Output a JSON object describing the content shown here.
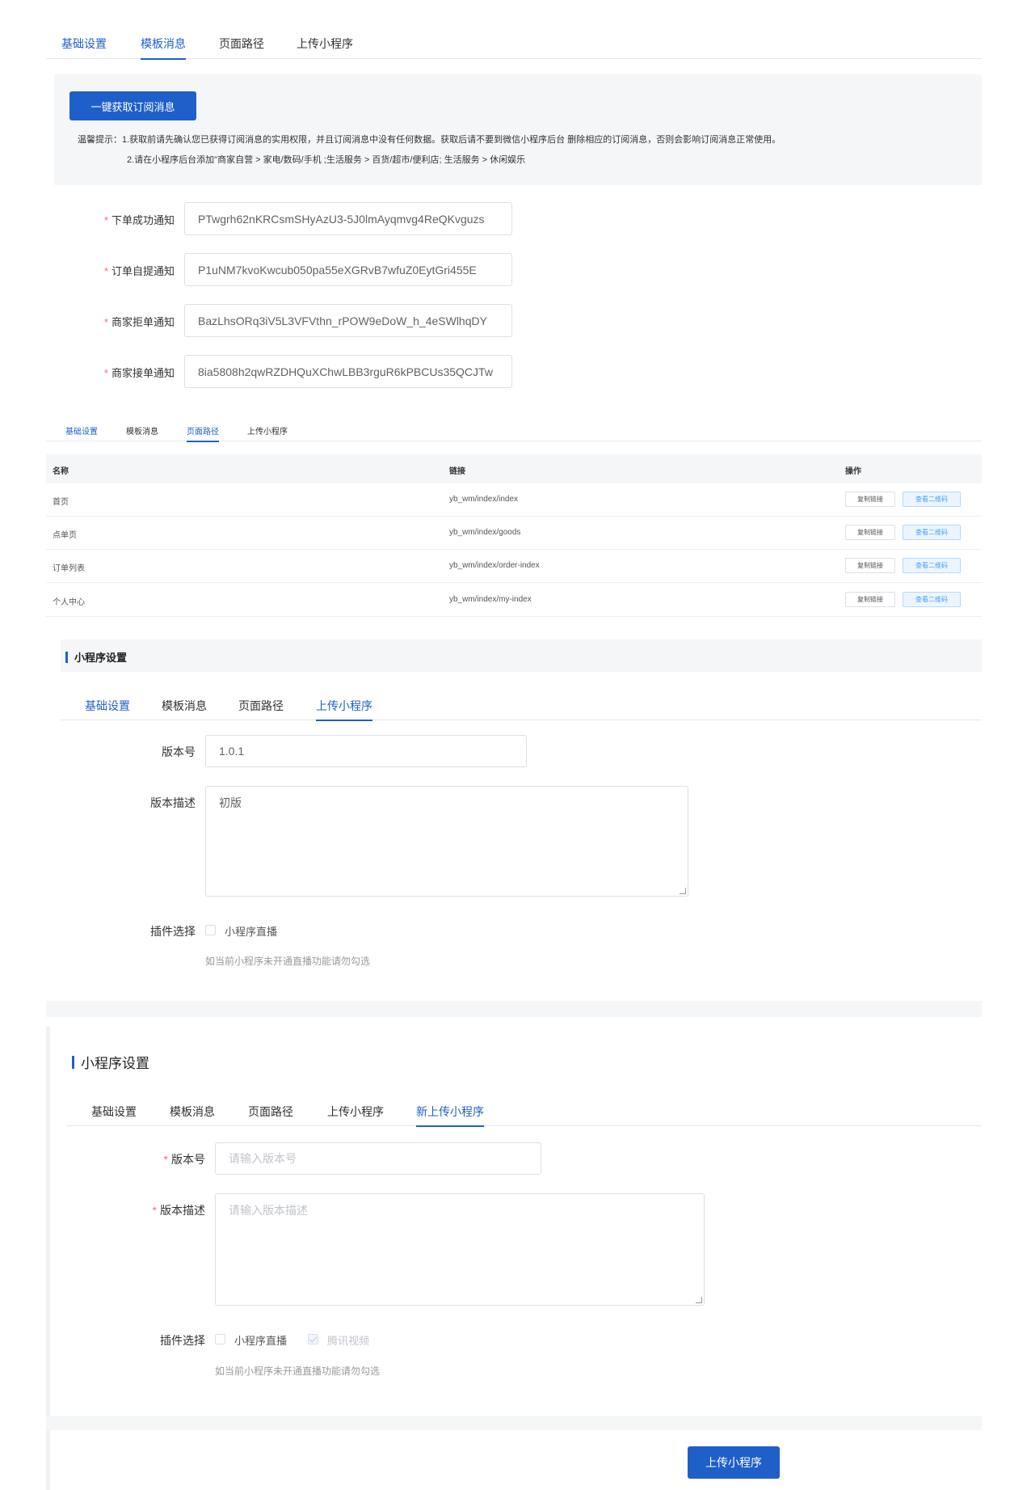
{
  "section1": {
    "tabs": [
      "基础设置",
      "模板消息",
      "页面路径",
      "上传小程序"
    ],
    "fetch_button": "一键获取订阅消息",
    "tip_line1": "温馨提示：1.获取前请先确认您已获得订阅消息的实用权限，并且订阅消息中没有任何数据。获取后请不要到微信小程序后台 删除相应的订阅消息，否则会影响订阅消息正常使用。",
    "tip_line2": "2.请在小程序后台添加\"商家自营 > 家电/数码/手机 ;生活服务 > 百货/超市/便利店; 生活服务 > 休闲娱乐",
    "fields": [
      {
        "label": "下单成功通知",
        "value": "PTwgrh62nKRCsmSHyAzU3-5J0lmAyqmvg4ReQKvguzs"
      },
      {
        "label": "订单自提通知",
        "value": "P1uNM7kvoKwcub050pa55eXGRvB7wfuZ0EytGri455E"
      },
      {
        "label": "商家拒单通知",
        "value": "BazLhsORq3iV5L3VFVthn_rPOW9eDoW_h_4eSWlhqDY"
      },
      {
        "label": "商家接单通知",
        "value": "8ia5808h2qwRZDHQuXChwLBB3rguR6kPBCUs35QCJTw"
      }
    ]
  },
  "section2": {
    "tabs": [
      "基础设置",
      "模板消息",
      "页面路径",
      "上传小程序"
    ],
    "columns": [
      "名称",
      "链接",
      "操作"
    ],
    "rows": [
      {
        "name": "首页",
        "link": "yb_wm/index/index"
      },
      {
        "name": "点单页",
        "link": "yb_wm/index/goods"
      },
      {
        "name": "订单列表",
        "link": "yb_wm/index/order-index"
      },
      {
        "name": "个人中心",
        "link": "yb_wm/index/my-index"
      }
    ],
    "copy_label": "复制链接",
    "qr_label": "查看二维码"
  },
  "section3": {
    "title": "小程序设置",
    "tabs": [
      "基础设置",
      "模板消息",
      "页面路径",
      "上传小程序"
    ],
    "version_label": "版本号",
    "version_value": "1.0.1",
    "desc_label": "版本描述",
    "desc_value": "初版",
    "plugin_label": "插件选择",
    "plugin_option": "小程序直播",
    "hint": "如当前小程序未开通直播功能请勿勾选"
  },
  "section4": {
    "title": "小程序设置",
    "tabs": [
      "基础设置",
      "模板消息",
      "页面路径",
      "上传小程序",
      "新上传小程序"
    ],
    "version_label": "版本号",
    "version_placeholder": "请输入版本号",
    "desc_label": "版本描述",
    "desc_placeholder": "请输入版本描述",
    "plugin_label": "插件选择",
    "plugin_option1": "小程序直播",
    "plugin_option2": "腾讯视频",
    "hint": "如当前小程序未开通直播功能请勿勾选",
    "upload_button": "上传小程序"
  },
  "colors": {
    "accent": "#1f5fc9",
    "required": "#f56c6c"
  }
}
